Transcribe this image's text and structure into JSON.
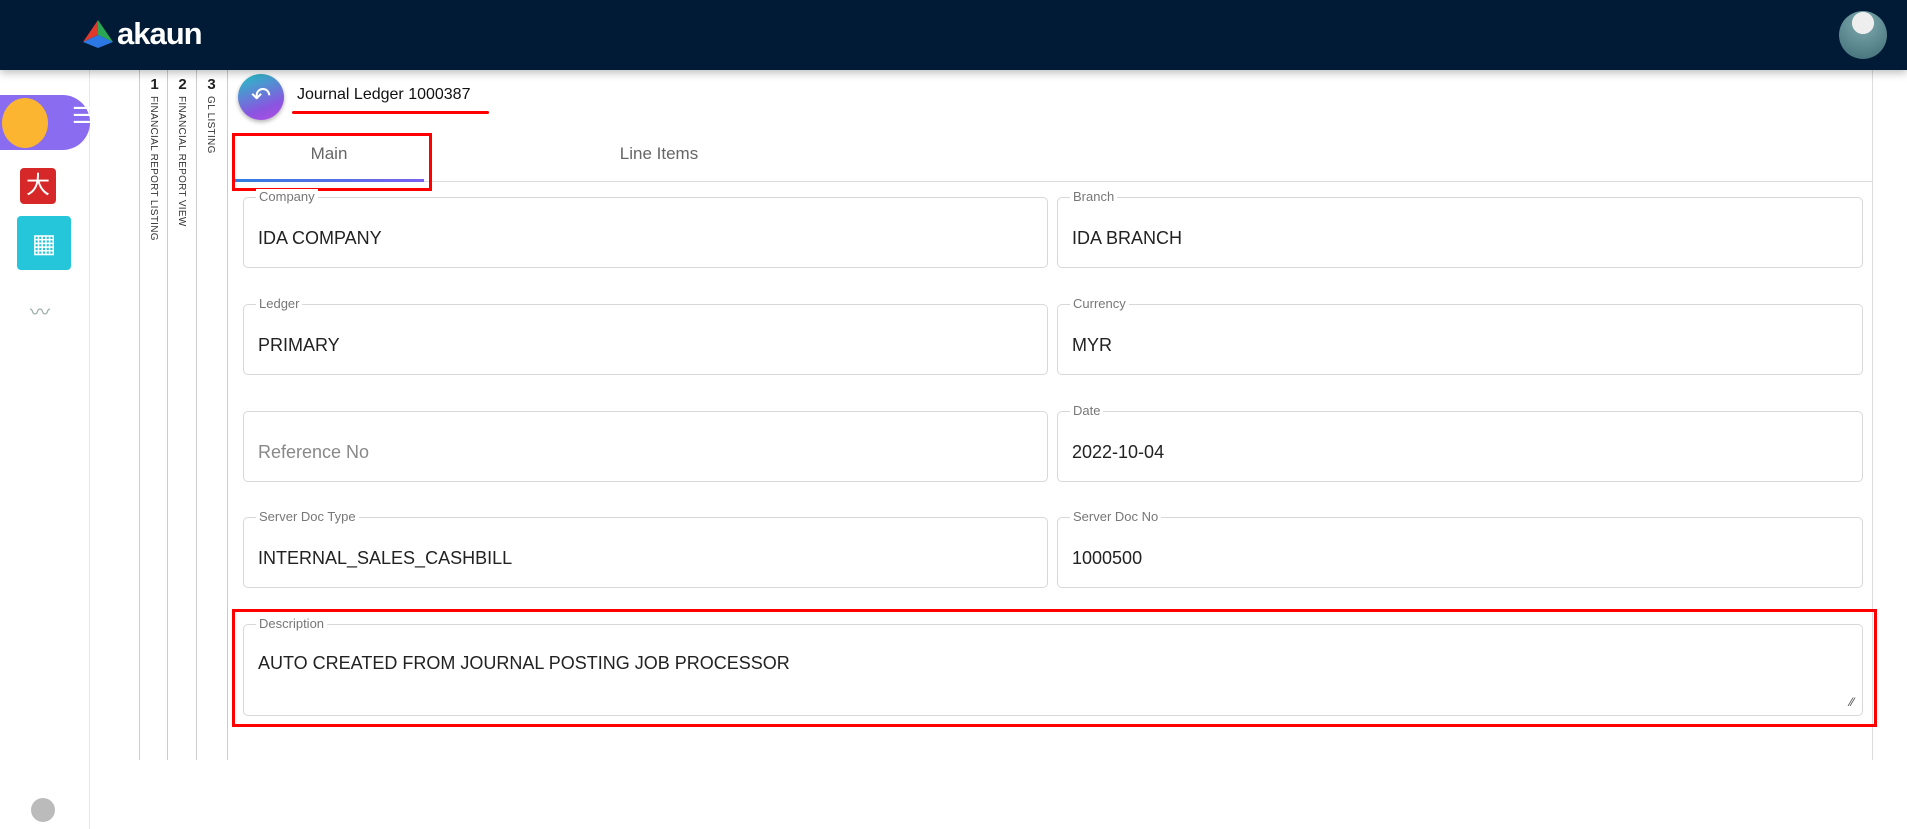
{
  "header": {
    "logo": "akaun"
  },
  "breadcrumbs": [
    {
      "num": "1",
      "label": "FINANCIAL REPORT LISTING"
    },
    {
      "num": "2",
      "label": "FINANCIAL REPORT VIEW"
    },
    {
      "num": "3",
      "label": "GL LISTING"
    }
  ],
  "page": {
    "title": "Journal Ledger 1000387"
  },
  "tabs": {
    "main": "Main",
    "line_items": "Line Items"
  },
  "form": {
    "company": {
      "label": "Company",
      "value": "IDA COMPANY"
    },
    "branch": {
      "label": "Branch",
      "value": "IDA BRANCH"
    },
    "ledger": {
      "label": "Ledger",
      "value": "PRIMARY"
    },
    "currency": {
      "label": "Currency",
      "value": "MYR"
    },
    "reference": {
      "placeholder": "Reference No"
    },
    "date": {
      "label": "Date",
      "value": "2022-10-04"
    },
    "server_doc_type": {
      "label": "Server Doc Type",
      "value": "INTERNAL_SALES_CASHBILL"
    },
    "server_doc_no": {
      "label": "Server Doc No",
      "value": "1000500"
    },
    "description": {
      "label": "Description",
      "value": "AUTO CREATED FROM JOURNAL POSTING JOB PROCESSOR"
    }
  }
}
